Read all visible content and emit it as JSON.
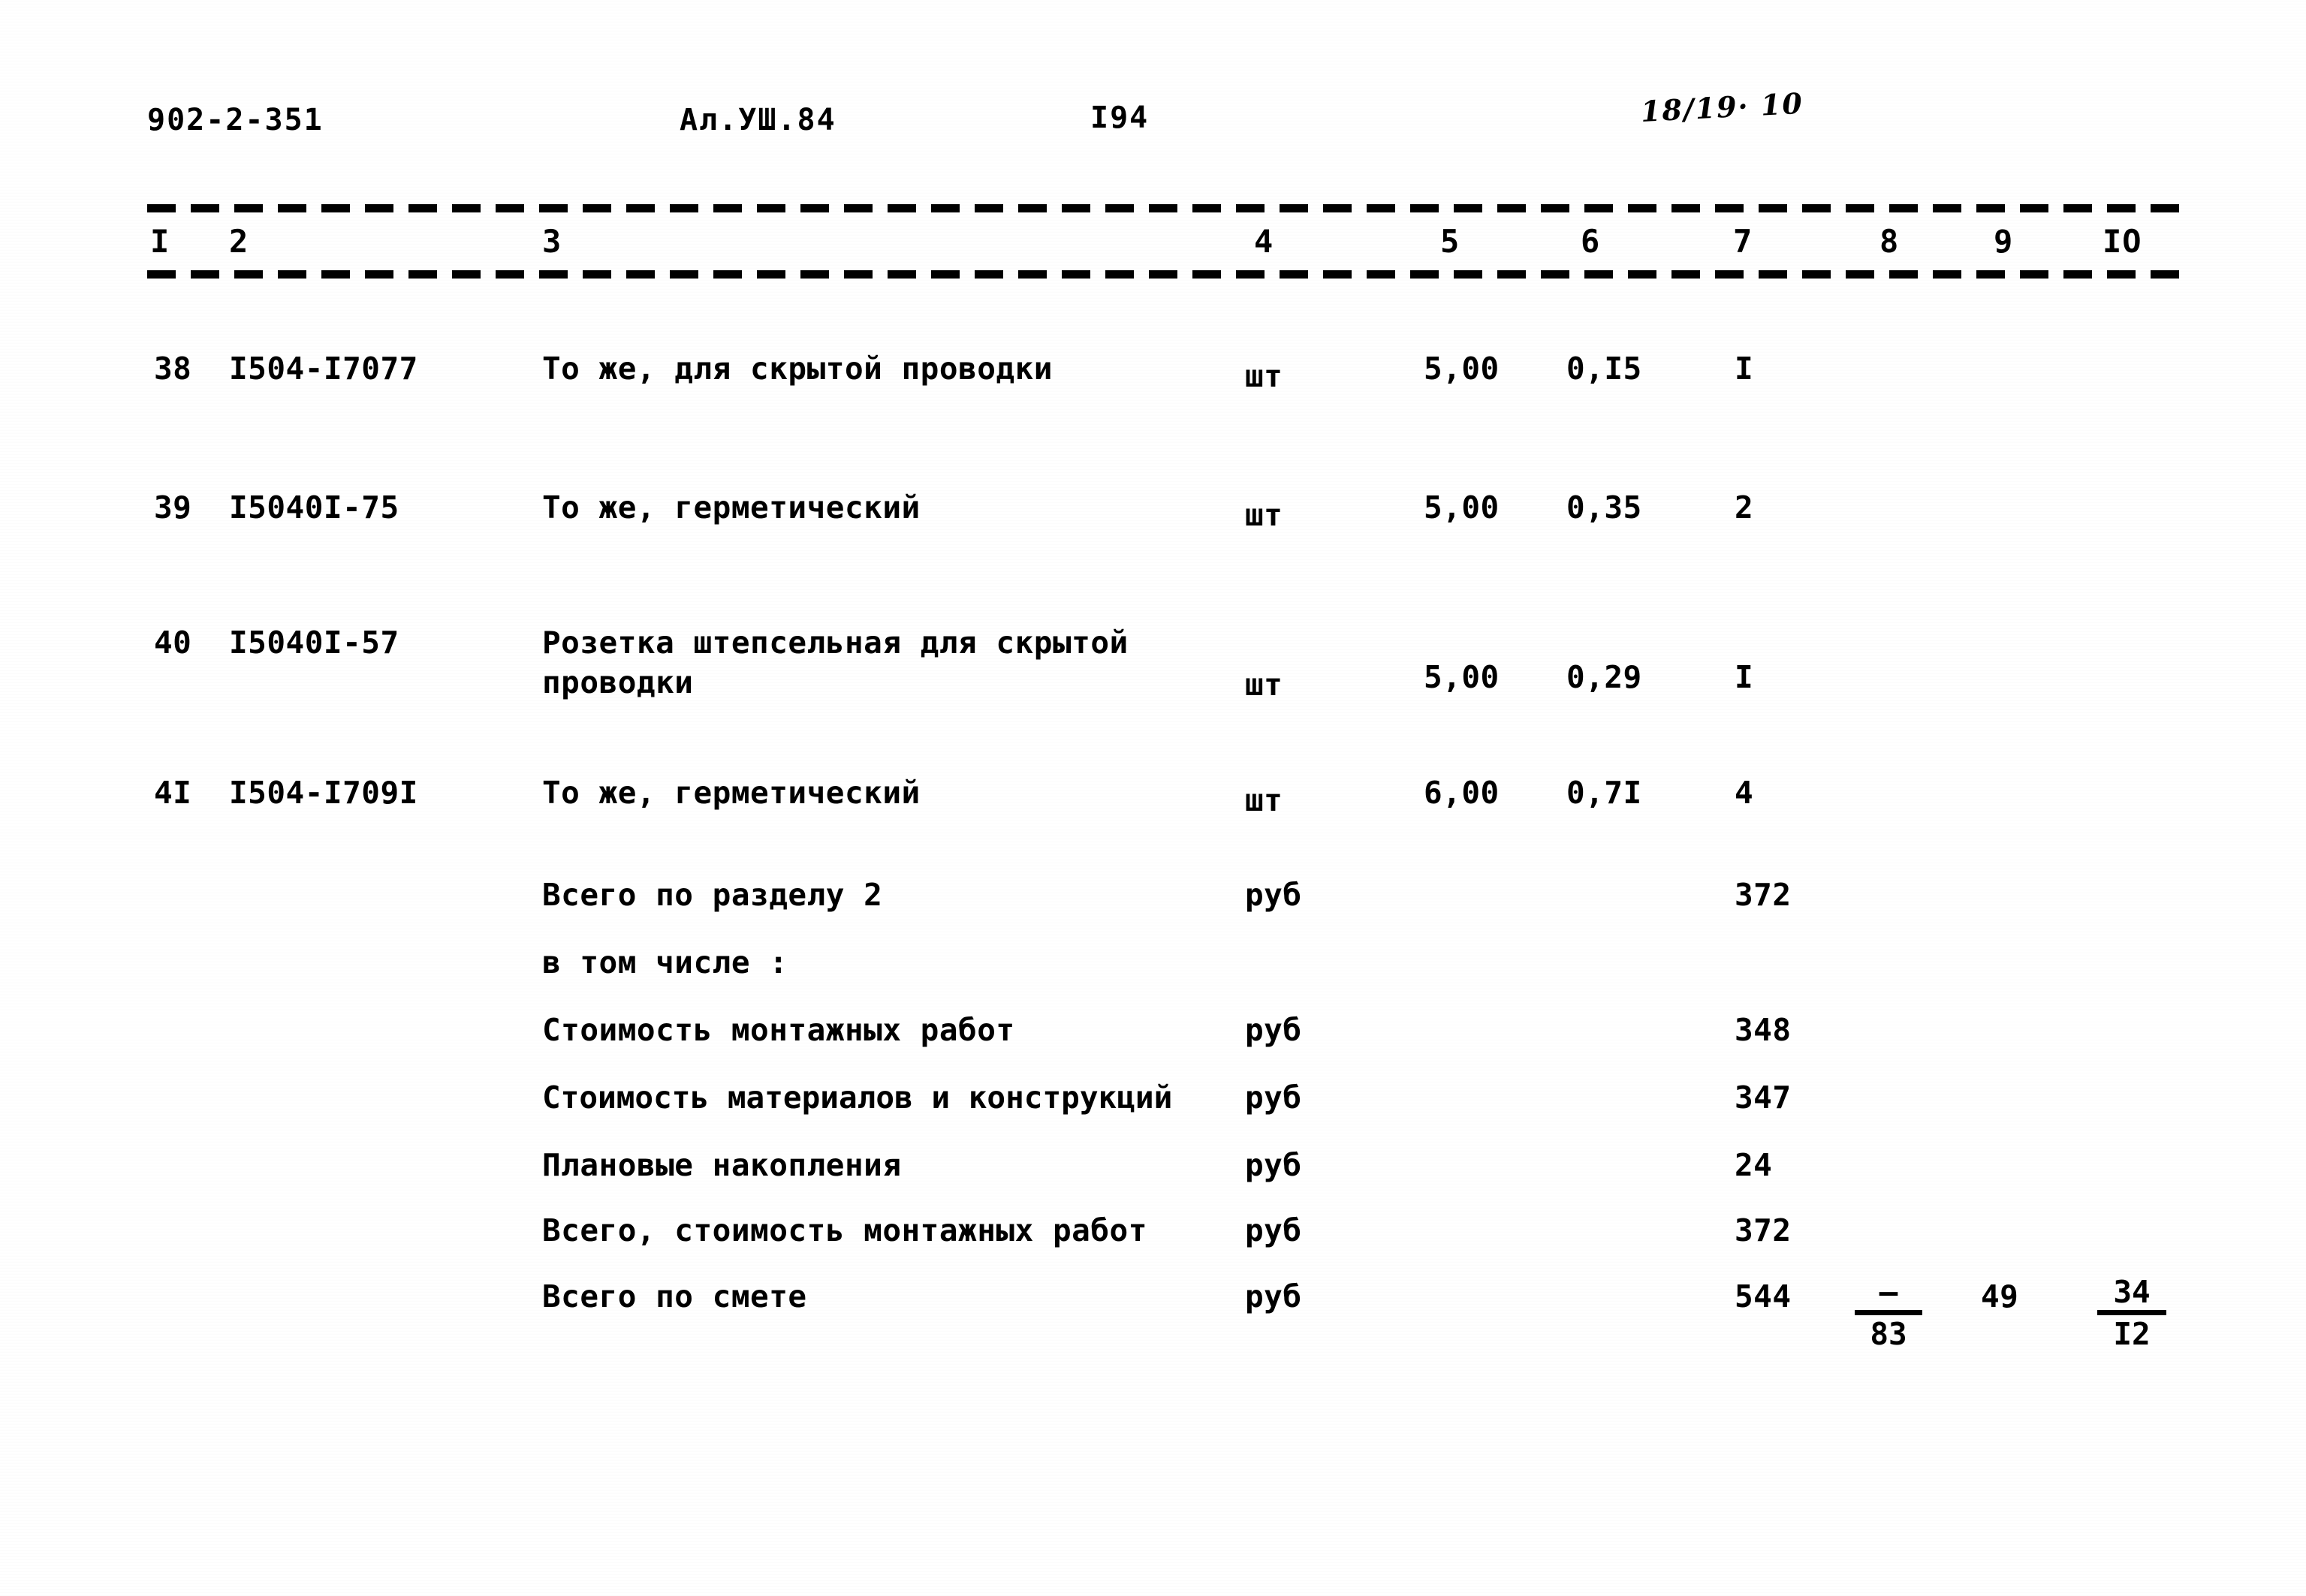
{
  "page": {
    "doc_code": "902-2-351",
    "album_ref": "Ал.УШ.84",
    "page_number": "I94",
    "handwritten_note": "18/19· 10"
  },
  "table": {
    "column_numbers": [
      "I",
      "2",
      "3",
      "4",
      "5",
      "6",
      "7",
      "8",
      "9",
      "IO"
    ],
    "rows": [
      {
        "num": "38",
        "code": "I504-I7077",
        "name": "То же, для скрытой проводки",
        "unit": "шт",
        "c5": "5,00",
        "c6": "0,I5",
        "c7": "I",
        "c8": "",
        "c9": "",
        "c10": ""
      },
      {
        "num": "39",
        "code": "I5040I-75",
        "name": "То же, герметический",
        "unit": "шт",
        "c5": "5,00",
        "c6": "0,35",
        "c7": "2",
        "c8": "",
        "c9": "",
        "c10": ""
      },
      {
        "num": "40",
        "code": "I5040I-57",
        "name_line1": "Розетка штепсельная для скрытой",
        "name_line2": "проводки",
        "unit": "шт",
        "c5": "5,00",
        "c6": "0,29",
        "c7": "I",
        "c8": "",
        "c9": "",
        "c10": ""
      },
      {
        "num": "4I",
        "code": "I504-I709I",
        "name": "То же, герметический",
        "unit": "шт",
        "c5": "6,00",
        "c6": "0,7I",
        "c7": "4",
        "c8": "",
        "c9": "",
        "c10": ""
      }
    ],
    "summary": [
      {
        "label": "Всего по разделу 2",
        "unit": "руб",
        "c7": "372"
      },
      {
        "label": "в том числе :",
        "unit": "",
        "c7": ""
      },
      {
        "label": "Стоимость монтажных работ",
        "unit": "руб",
        "c7": "348"
      },
      {
        "label": "Стоимость материалов и конструкций",
        "unit": "руб",
        "c7": "347"
      },
      {
        "label": "Плановые накопления",
        "unit": "руб",
        "c7": "24"
      },
      {
        "label": "Всего, стоимость монтажных работ",
        "unit": "руб",
        "c7": "372"
      },
      {
        "label": "Всего по смете",
        "unit": "руб",
        "c7": "544"
      }
    ],
    "total_fractions": {
      "c8_numerator": "–",
      "c8_denominator": "83",
      "c9": "49",
      "c10_numerator": "34",
      "c10_denominator": "I2"
    }
  }
}
